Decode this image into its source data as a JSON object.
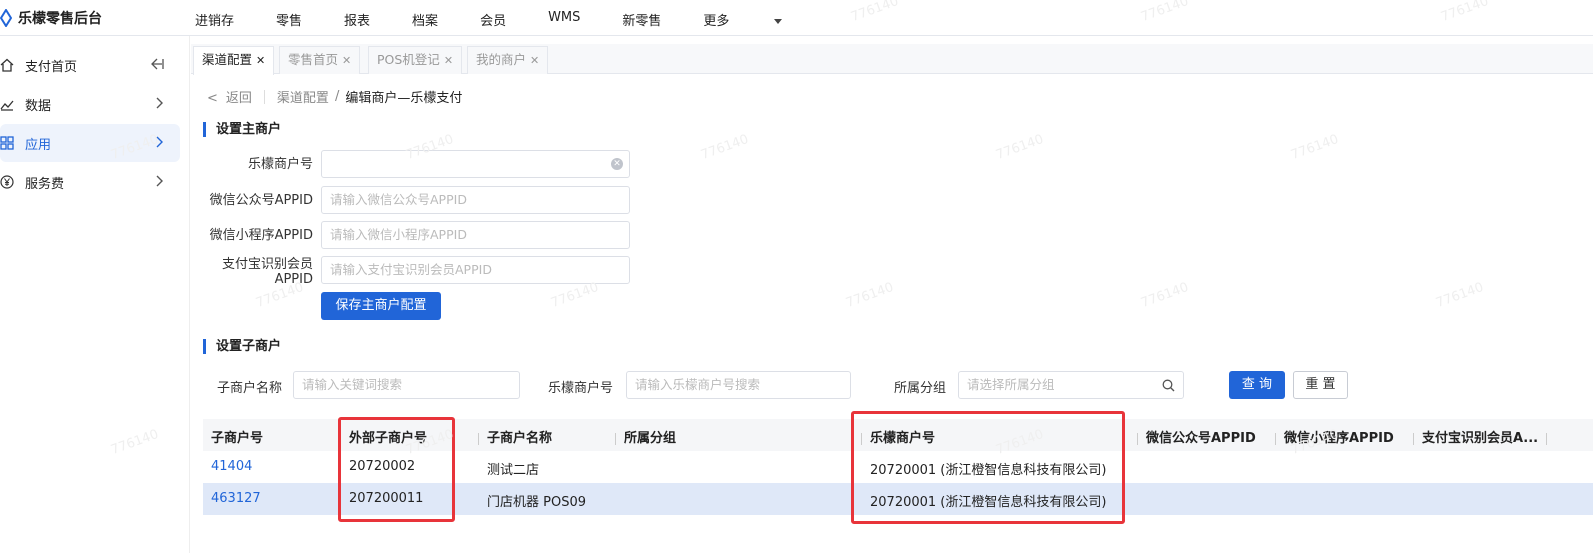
{
  "brand": {
    "name": "乐檬零售后台"
  },
  "nav": [
    "进销存",
    "零售",
    "报表",
    "档案",
    "会员",
    "WMS",
    "新零售",
    "更多"
  ],
  "sidebar": {
    "items": [
      {
        "label": "支付首页",
        "icon": "home-icon"
      },
      {
        "label": "数据",
        "icon": "chart-icon"
      },
      {
        "label": "应用",
        "icon": "grid-icon"
      },
      {
        "label": "服务费",
        "icon": "yen-icon"
      }
    ]
  },
  "tabs": [
    {
      "label": "渠道配置",
      "active": true
    },
    {
      "label": "零售首页",
      "active": false
    },
    {
      "label": "POS机登记",
      "active": false
    },
    {
      "label": "我的商户",
      "active": false
    }
  ],
  "breadcrumb": {
    "back": "返回",
    "parent": "渠道配置",
    "sep": "/",
    "current": "编辑商户—乐檬支付"
  },
  "main_merchant": {
    "title": "设置主商户",
    "fields": [
      {
        "label": "乐檬商户号",
        "value": "",
        "placeholder": ""
      },
      {
        "label": "微信公众号APPID",
        "value": "",
        "placeholder": "请输入微信公众号APPID"
      },
      {
        "label": "微信小程序APPID",
        "value": "",
        "placeholder": "请输入微信小程序APPID"
      },
      {
        "label": "支付宝识别会员APPID",
        "value": "",
        "placeholder": "请输入支付宝识别会员APPID"
      }
    ],
    "save_label": "保存主商户配置"
  },
  "sub_merchant": {
    "title": "设置子商户",
    "filters": [
      {
        "label": "子商户名称",
        "placeholder": "请输入关键词搜索"
      },
      {
        "label": "乐檬商户号",
        "placeholder": "请输入乐檬商户号搜索"
      },
      {
        "label": "所属分组",
        "placeholder": "请选择所属分组"
      }
    ],
    "query_label": "查 询",
    "reset_label": "重 置",
    "columns": [
      "子商户号",
      "外部子商户号",
      "子商户名称",
      "所属分组",
      "乐檬商户号",
      "微信公众号APPID",
      "微信小程序APPID",
      "支付宝识别会员A..."
    ],
    "rows": [
      [
        "41404",
        "20720002",
        "测试二店",
        "",
        "20720001 (浙江橙智信息科技有限公司)",
        "",
        "",
        ""
      ],
      [
        "463127",
        "207200011",
        "门店机器 POS09",
        "",
        "20720001 (浙江橙智信息科技有限公司)",
        "",
        "",
        ""
      ]
    ]
  },
  "watermark": "776140",
  "colors": {
    "accent": "#2165d8",
    "highlight": "#e8343a",
    "selected_row": "#dfe8f8"
  }
}
